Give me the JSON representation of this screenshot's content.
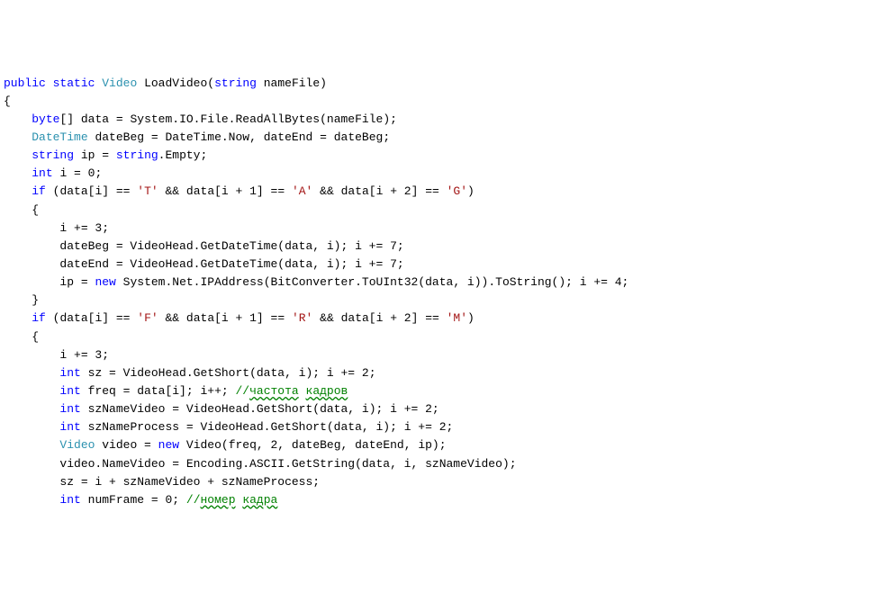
{
  "code": {
    "kw_public": "public",
    "kw_static": "static",
    "kw_string": "string",
    "kw_byte": "byte",
    "kw_int": "int",
    "kw_if": "if",
    "kw_new": "new",
    "typ_Video": "Video",
    "typ_DateTime": "DateTime",
    "fn_LoadVideo": "LoadVideo",
    "param_nameFile": "nameFile",
    "l3_data": "data",
    "l3_expr": "System.IO.File.ReadAllBytes(nameFile);",
    "l4_dateBeg": "dateBeg",
    "l4_now": "DateTime.Now",
    "l4_dateEnd": "dateEnd",
    "l4_assign": "dateBeg;",
    "l5_ip": "ip",
    "l5_stringEmpty": ".Empty;",
    "l6_i": "i",
    "l6_zero": "0",
    "l7_cond_a": "(data[i] ==",
    "l7_T": "'T'",
    "l7_and": "&&",
    "l7_cond_b": "data[i + 1] ==",
    "l7_A": "'A'",
    "l7_cond_c": "data[i + 2] ==",
    "l7_G": "'G'",
    "l9_inc3": "i += 3;",
    "l10_dateBeg": "dateBeg = VideoHead.GetDateTime(data, i); i += 7;",
    "l11_dateEnd": "dateEnd = VideoHead.GetDateTime(data, i); i += 7;",
    "l12_a": "ip =",
    "l12_b": "System.Net.IPAddress(BitConverter.ToUInt32(data, i)).ToString(); i += 4;",
    "l14_cond_a": "(data[i] ==",
    "l14_F": "'F'",
    "l14_cond_b": "data[i + 1] ==",
    "l14_R": "'R'",
    "l14_cond_c": "data[i + 2] ==",
    "l14_M": "'M'",
    "l16_inc3": "i += 3;",
    "l17_sz": "sz = VideoHead.GetShort(data, i); i += 2;",
    "l18_freq_a": "freq = data[i]; i++;",
    "l18_comment_prefix": "//",
    "l18_comment_word1": "частота",
    "l18_comment_word2": "кадров",
    "l19_szNameVideo": "szNameVideo = VideoHead.GetShort(data, i); i += 2;",
    "l20_szNameProcess": "szNameProcess = VideoHead.GetShort(data, i); i += 2;",
    "l21_a": "video =",
    "l21_b": "Video(freq, 2, dateBeg, dateEnd, ip);",
    "l22": "video.NameVideo = Encoding.ASCII.GetString(data, i, szNameVideo);",
    "l23": "sz = i + szNameVideo + szNameProcess;",
    "l24_a": "numFrame =",
    "l24_zero": "0",
    "l24_comment_prefix": "//",
    "l24_comment_word1": "номер",
    "l24_comment_word2": "кадра"
  }
}
